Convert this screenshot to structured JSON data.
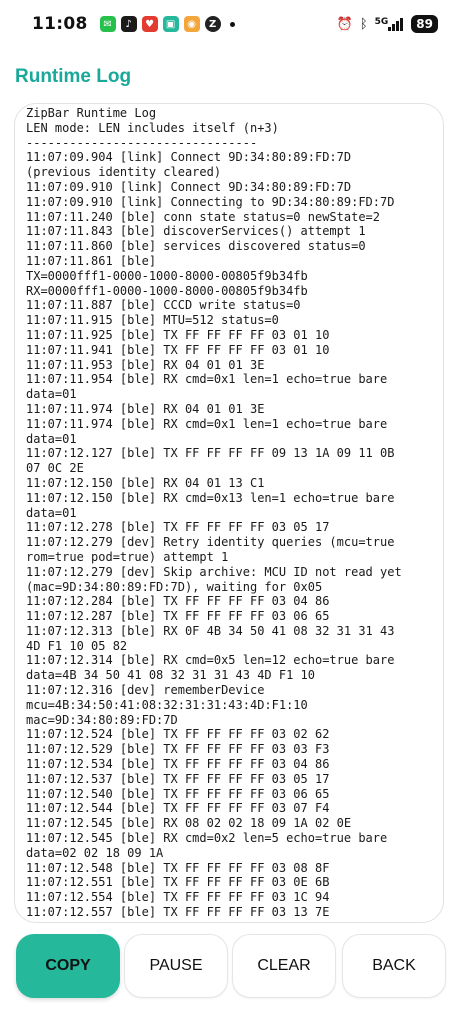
{
  "status_bar": {
    "time": "11:08",
    "notification_icons": [
      "wechat-icon",
      "tiktok-icon",
      "pinduoduo-icon",
      "xiaohongshu-icon",
      "mail-app-icon",
      "z-app-icon"
    ],
    "network": "5G",
    "battery": "89",
    "colors": {
      "wechat": "#26c04c",
      "tiktok": "#1b1b1b",
      "pinduoduo": "#e23b2f",
      "xiaohongshu": "#25b89a",
      "mail": "#f2a63b",
      "z": "#222222"
    }
  },
  "page": {
    "title": "Runtime Log",
    "accent_color": "#1aa89a"
  },
  "log": {
    "lines": [
      "ZipBar Runtime Log",
      "LEN mode: LEN includes itself (n+3)",
      "--------------------------------",
      "11:07:09.904 [link] Connect 9D:34:80:89:FD:7D",
      "(previous identity cleared)",
      "11:07:09.910 [link] Connect 9D:34:80:89:FD:7D",
      "11:07:09.910 [link] Connecting to 9D:34:80:89:FD:7D",
      "11:07:11.240 [ble] conn state status=0 newState=2",
      "11:07:11.843 [ble] discoverServices() attempt 1",
      "11:07:11.860 [ble] services discovered status=0",
      "11:07:11.861 [ble]",
      "TX=0000fff1-0000-1000-8000-00805f9b34fb",
      "RX=0000fff1-0000-1000-8000-00805f9b34fb",
      "11:07:11.887 [ble] CCCD write status=0",
      "11:07:11.915 [ble] MTU=512 status=0",
      "11:07:11.925 [ble] TX FF FF FF FF 03 01 10",
      "11:07:11.941 [ble] TX FF FF FF FF 03 01 10",
      "11:07:11.953 [ble] RX 04 01 01 3E",
      "11:07:11.954 [ble] RX cmd=0x1 len=1 echo=true bare",
      "data=01",
      "11:07:11.974 [ble] RX 04 01 01 3E",
      "11:07:11.974 [ble] RX cmd=0x1 len=1 echo=true bare",
      "data=01",
      "11:07:12.127 [ble] TX FF FF FF FF 09 13 1A 09 11 0B",
      "07 0C 2E",
      "11:07:12.150 [ble] RX 04 01 13 C1",
      "11:07:12.150 [ble] RX cmd=0x13 len=1 echo=true bare",
      "data=01",
      "11:07:12.278 [ble] TX FF FF FF FF 03 05 17",
      "11:07:12.279 [dev] Retry identity queries (mcu=true",
      "rom=true pod=true) attempt 1",
      "11:07:12.279 [dev] Skip archive: MCU ID not read yet",
      "(mac=9D:34:80:89:FD:7D), waiting for 0x05",
      "11:07:12.284 [ble] TX FF FF FF FF 03 04 86",
      "11:07:12.287 [ble] TX FF FF FF FF 03 06 65",
      "11:07:12.313 [ble] RX 0F 4B 34 50 41 08 32 31 31 43",
      "4D F1 10 05 82",
      "11:07:12.314 [ble] RX cmd=0x5 len=12 echo=true bare",
      "data=4B 34 50 41 08 32 31 31 43 4D F1 10",
      "11:07:12.316 [dev] rememberDevice",
      "mcu=4B:34:50:41:08:32:31:31:43:4D:F1:10",
      "mac=9D:34:80:89:FD:7D",
      "11:07:12.524 [ble] TX FF FF FF FF 03 02 62",
      "11:07:12.529 [ble] TX FF FF FF FF 03 03 F3",
      "11:07:12.534 [ble] TX FF FF FF FF 03 04 86",
      "11:07:12.537 [ble] TX FF FF FF FF 03 05 17",
      "11:07:12.540 [ble] TX FF FF FF FF 03 06 65",
      "11:07:12.544 [ble] TX FF FF FF FF 03 07 F4",
      "11:07:12.545 [ble] RX 08 02 02 18 09 1A 02 0E",
      "11:07:12.545 [ble] RX cmd=0x2 len=5 echo=true bare",
      "data=02 02 18 09 1A",
      "11:07:12.548 [ble] TX FF FF FF FF 03 08 8F",
      "11:07:12.551 [ble] TX FF FF FF FF 03 0E 6B",
      "11:07:12.554 [ble] TX FF FF FF FF 03 1C 94",
      "11:07:12.557 [ble] TX FF FF FF FF 03 13 7E"
    ]
  },
  "buttons": {
    "copy": "COPY",
    "pause": "PAUSE",
    "clear": "CLEAR",
    "back": "BACK",
    "primary_color": "#25b89a"
  }
}
